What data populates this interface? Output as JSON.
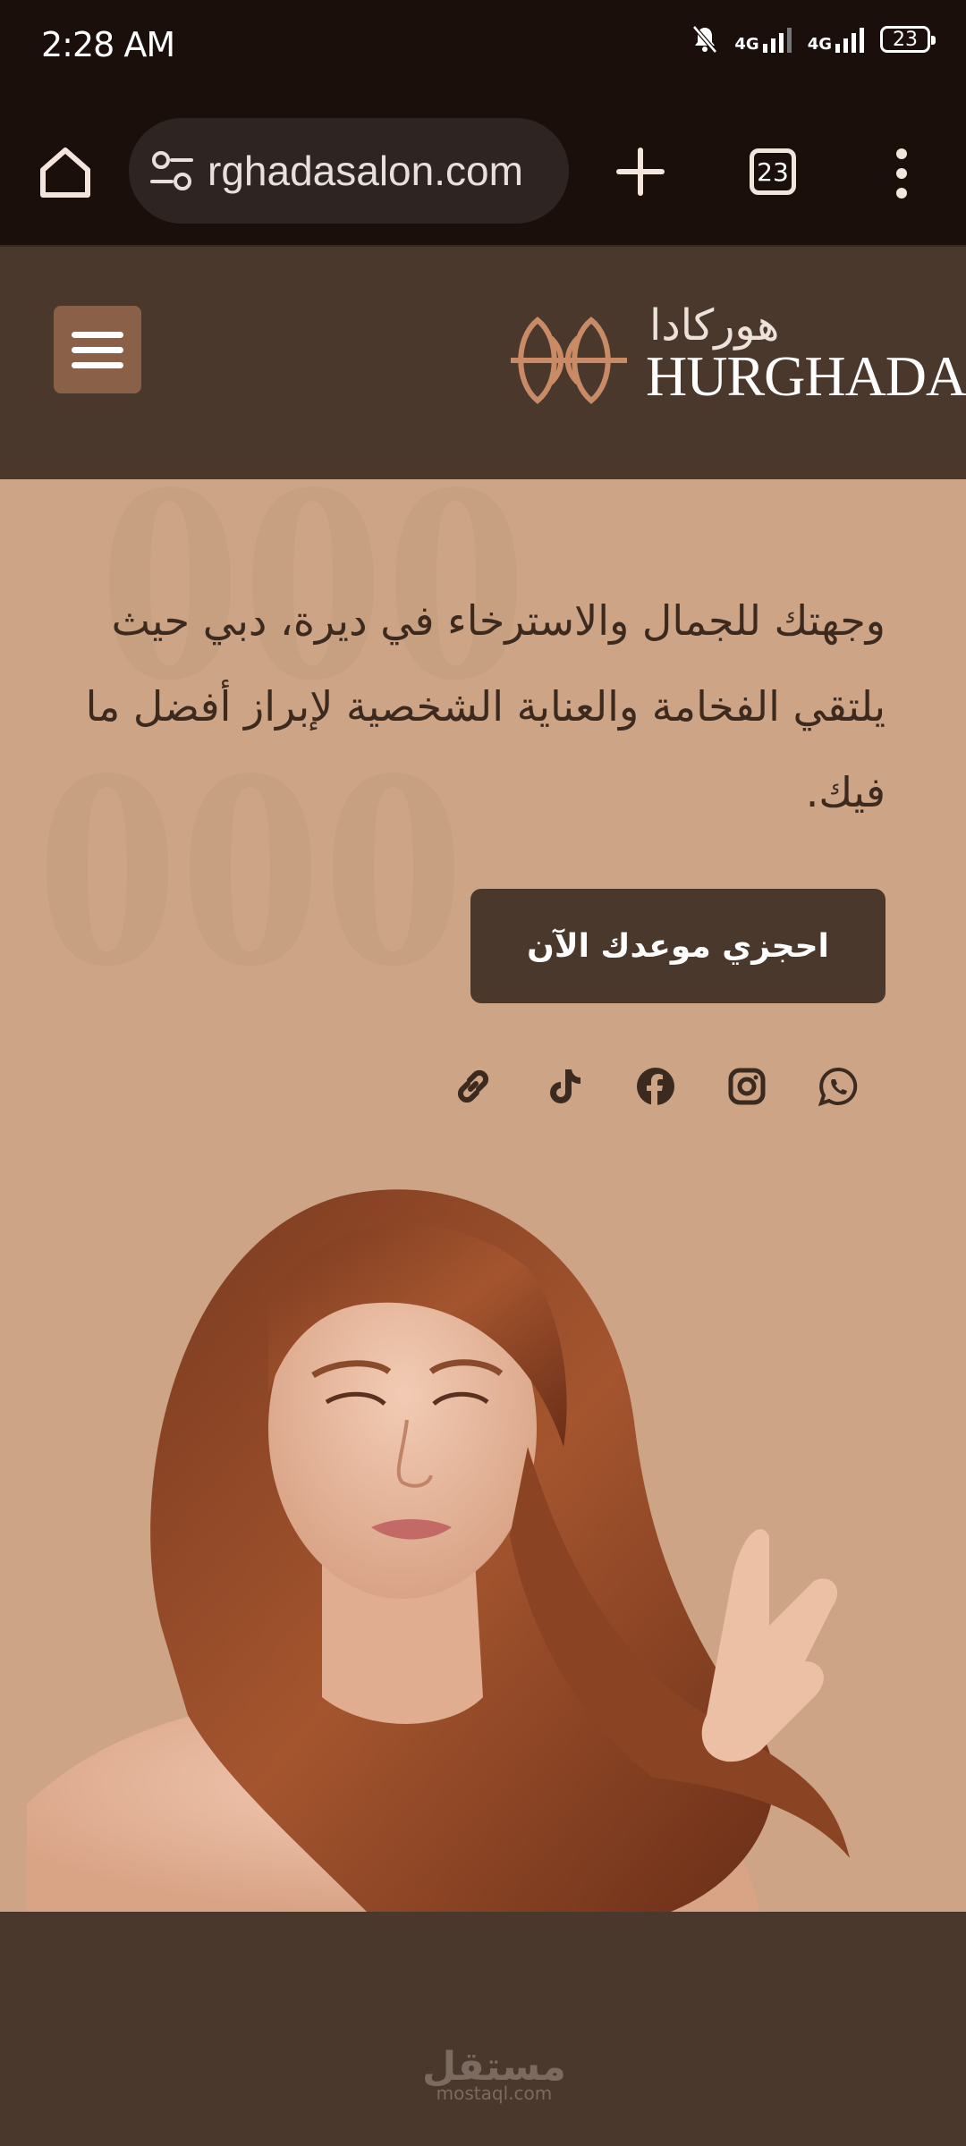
{
  "status_bar": {
    "time": "2:28 AM",
    "network1": "4G",
    "network2": "4G",
    "battery": "23"
  },
  "browser": {
    "url": "rghadasalon.com",
    "tab_count": "23"
  },
  "site": {
    "logo_arabic": "هوركادا",
    "logo_english": "HURGHADA"
  },
  "hero": {
    "description": "وجهتك للجمال والاسترخاء في ديرة، دبي حيث يلتقي الفخامة والعناية الشخصية لإبراز أفضل ما فيك.",
    "cta_label": "احجزي موعدك الآن"
  },
  "social_icons": [
    "link-icon",
    "tiktok-icon",
    "facebook-icon",
    "instagram-icon",
    "whatsapp-icon"
  ],
  "footer": {
    "watermark_ar": "مستقل",
    "watermark_en": "mostaql.com"
  },
  "colors": {
    "status_bg": "#1a0f0b",
    "header_bg": "#4a382c",
    "hero_bg": "#cda486",
    "menu_button": "#8a6048",
    "logo_accent": "#c98a66"
  }
}
